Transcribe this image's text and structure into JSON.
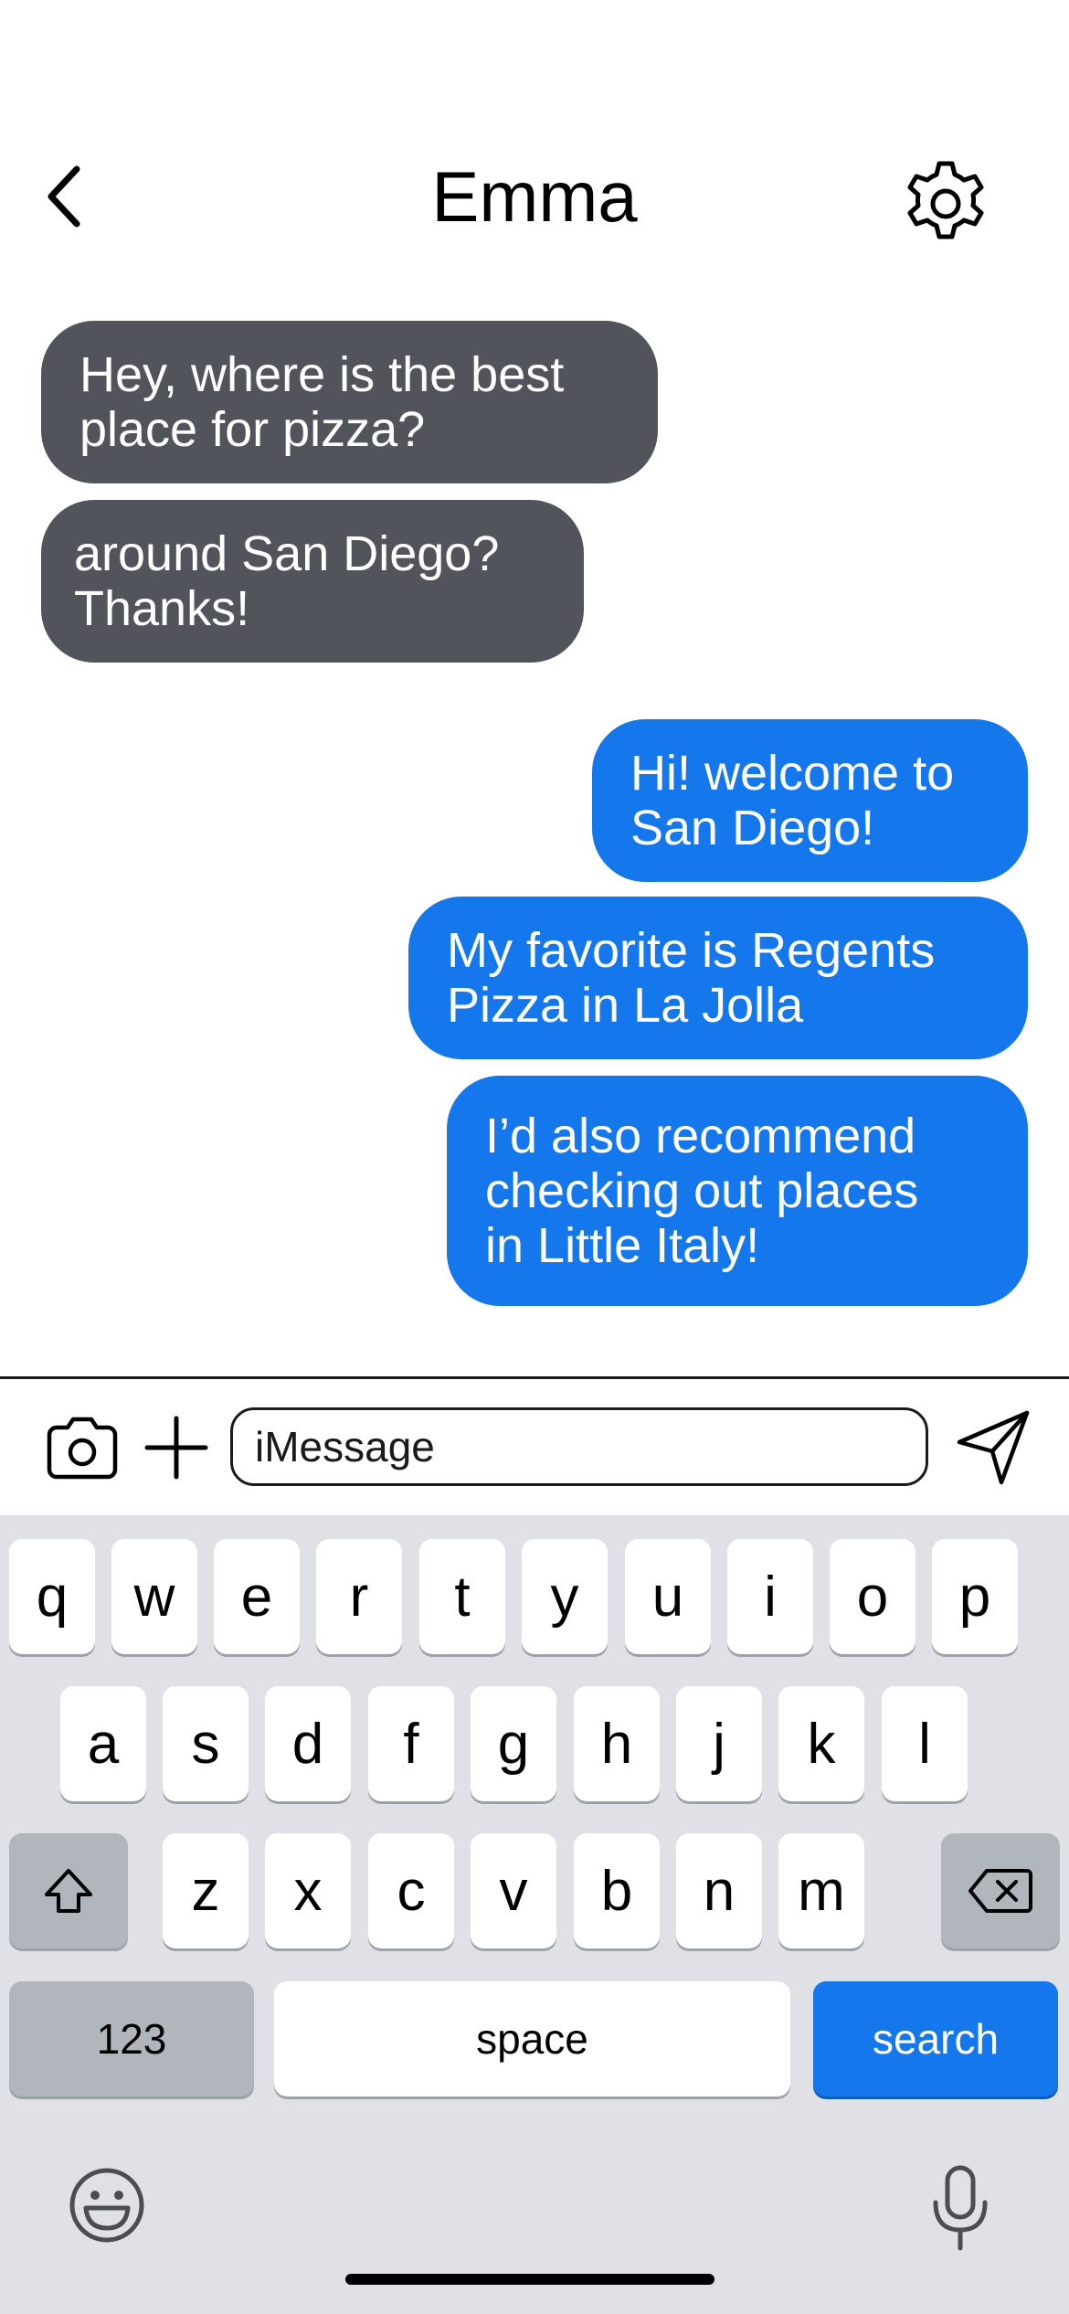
{
  "header": {
    "contact_name": "Emma",
    "back_icon": "chevron-left-icon",
    "settings_icon": "gear-icon"
  },
  "messages": [
    {
      "direction": "incoming",
      "text": "Hey, where is the best\nplace for pizza?"
    },
    {
      "direction": "incoming",
      "text": "around San Diego?\nThanks!"
    },
    {
      "direction": "outgoing",
      "text": "Hi! welcome to\nSan Diego!"
    },
    {
      "direction": "outgoing",
      "text": "My favorite is Regents\nPizza in La Jolla"
    },
    {
      "direction": "outgoing",
      "text": "I’d also recommend\nchecking out places\nin Little Italy!"
    }
  ],
  "composer": {
    "placeholder": "iMessage",
    "value": "",
    "camera_icon": "camera-icon",
    "plus_icon": "plus-icon",
    "send_icon": "send-icon"
  },
  "keyboard": {
    "row1": [
      "q",
      "w",
      "e",
      "r",
      "t",
      "y",
      "u",
      "i",
      "o",
      "p"
    ],
    "row2": [
      "a",
      "s",
      "d",
      "f",
      "g",
      "h",
      "j",
      "k",
      "l"
    ],
    "row3": [
      "z",
      "x",
      "c",
      "v",
      "b",
      "n",
      "m"
    ],
    "shift_icon": "shift-icon",
    "delete_icon": "delete-icon",
    "numbers_label": "123",
    "space_label": "space",
    "action_label": "search",
    "emoji_icon": "emoji-icon",
    "mic_icon": "microphone-icon"
  },
  "colors": {
    "incoming_bubble": "#51555b",
    "outgoing_bubble": "#1478ec",
    "keyboard_bg": "#dfe1e6",
    "accent": "#1478ec"
  }
}
